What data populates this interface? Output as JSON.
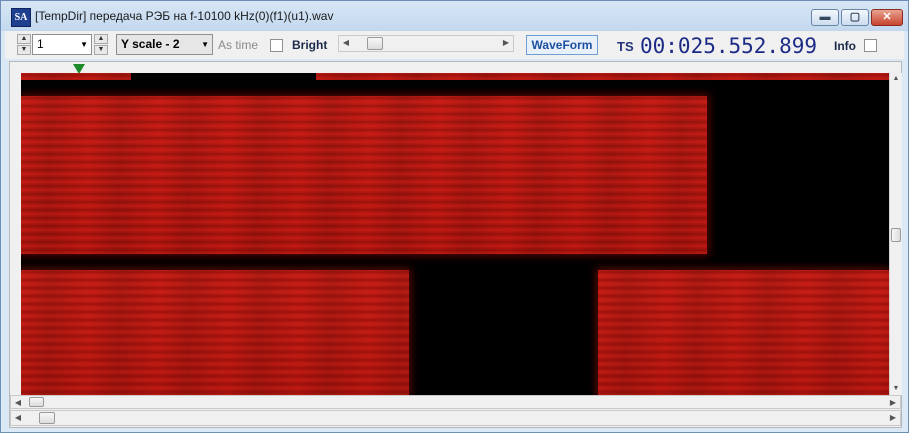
{
  "window": {
    "title": "[TempDir] передача РЭБ на f-10100 kHz(0)(f1)(u1).wav",
    "icon_letters": "SA",
    "min_glyph": "▬",
    "max_glyph": "▢",
    "close_glyph": "✕"
  },
  "toolbar": {
    "channel_value": "1",
    "yscale_value": "Y scale - 2",
    "as_time_label": "As time",
    "bright_label": "Bright",
    "waveform_label": "WaveForm",
    "ts_label": "TS",
    "timestamp": "00:025.552.899",
    "info_label": "Info"
  },
  "colors": {
    "spectrogram_signal": "#c21a12",
    "spectrogram_background": "#000000",
    "timestamp_text": "#1c2b86",
    "marker": "#1c8a2a"
  }
}
